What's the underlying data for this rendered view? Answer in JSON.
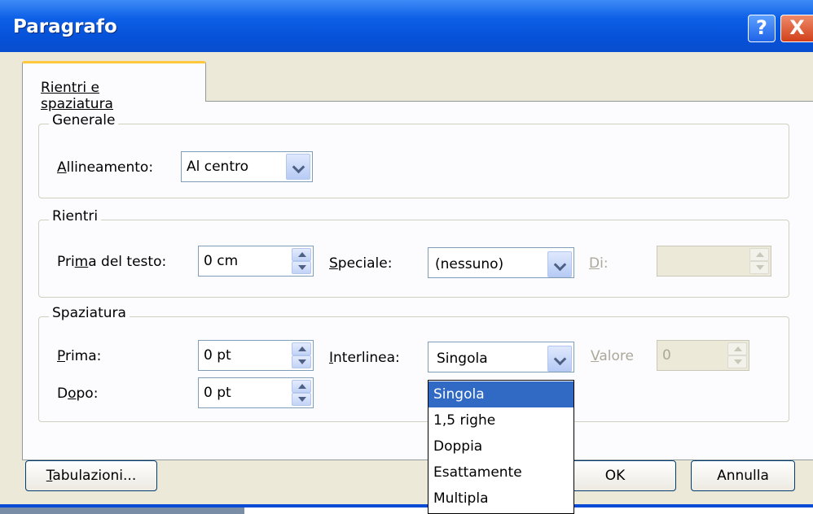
{
  "title": "Paragrafo",
  "title_buttons": {
    "help": "?",
    "close": "X"
  },
  "tab": {
    "label": "Rientri e spaziatura"
  },
  "generale": {
    "title": "Generale",
    "alignment_label_pre": "",
    "alignment_label_u": "A",
    "alignment_label_post": "llineamento:",
    "alignment_value": "Al centro"
  },
  "rientri": {
    "title": "Rientri",
    "before_label_pre": "Pri",
    "before_label_u": "m",
    "before_label_post": "a del testo:",
    "before_value": "0 cm",
    "special_label_pre": "",
    "special_label_u": "S",
    "special_label_post": "peciale:",
    "special_value": "(nessuno)",
    "by_label_u": "D",
    "by_label_post": "i:",
    "by_value": ""
  },
  "spaziatura": {
    "title": "Spaziatura",
    "before_label_u": "P",
    "before_label_post": "rima:",
    "before_value": "0 pt",
    "after_label_pre": "D",
    "after_label_u": "o",
    "after_label_post": "po:",
    "after_value": "0 pt",
    "line_label_u": "I",
    "line_label_post": "nterlinea:",
    "line_value": "Singola",
    "value_label_u": "V",
    "value_label_post": "alore",
    "value_value": "0"
  },
  "line_spacing_options": [
    "Singola",
    "1,5 righe",
    "Doppia",
    "Esattamente",
    "Multipla"
  ],
  "line_spacing_selected_index": 0,
  "buttons": {
    "tabs_u": "T",
    "tabs_post": "abulazioni...",
    "ok": "OK",
    "cancel": "Annulla"
  },
  "colors": {
    "title_bar": "#0a4bd6",
    "selection": "#316ac5",
    "tab_accent": "#ffc83c"
  }
}
